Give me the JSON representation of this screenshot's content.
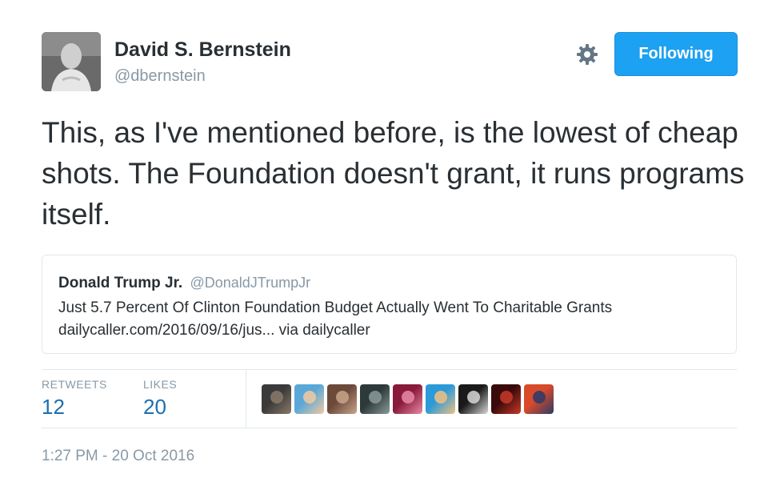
{
  "author": {
    "name": "David S. Bernstein",
    "handle": "@dbernstein"
  },
  "actions": {
    "follow_label": "Following",
    "settings_icon": "gear-icon"
  },
  "tweet": {
    "text": "This, as I've mentioned before, is the lowest of cheap shots. The Foundation doesn't grant, it runs programs itself."
  },
  "quoted_tweet": {
    "name": "Donald Trump Jr.",
    "handle": "@DonaldJTrumpJr",
    "line1": "Just 5.7 Percent Of Clinton Foundation Budget Actually Went To Charitable Grants",
    "line2": "dailycaller.com/2016/09/16/jus... via dailycaller"
  },
  "stats": {
    "retweets_label": "RETWEETS",
    "retweets_count": "12",
    "likes_label": "LIKES",
    "likes_count": "20"
  },
  "likers": [
    {
      "name": "liker-avatar-1",
      "colors": [
        "#3a3a3a",
        "#8a7a6a"
      ]
    },
    {
      "name": "liker-avatar-2",
      "colors": [
        "#5aa8d8",
        "#f2c9a0"
      ]
    },
    {
      "name": "liker-avatar-3",
      "colors": [
        "#6b4a3a",
        "#c9a48a"
      ]
    },
    {
      "name": "liker-avatar-4",
      "colors": [
        "#2e3a3a",
        "#8a9a9a"
      ]
    },
    {
      "name": "liker-avatar-5",
      "colors": [
        "#8a1a3a",
        "#e88aa8"
      ]
    },
    {
      "name": "liker-avatar-6",
      "colors": [
        "#2a9ad8",
        "#f2c080"
      ]
    },
    {
      "name": "liker-avatar-7",
      "colors": [
        "#1a1a1a",
        "#d8d8d8"
      ]
    },
    {
      "name": "liker-avatar-8",
      "colors": [
        "#3a0a0a",
        "#c83a2a"
      ]
    },
    {
      "name": "liker-avatar-9",
      "colors": [
        "#d84a2a",
        "#2a3a6a"
      ]
    }
  ],
  "timestamp": "1:27 PM - 20 Oct 2016",
  "colors": {
    "accent": "#1da1f2",
    "link": "#1b6fb0",
    "muted": "#8899a6",
    "text": "#292f33"
  }
}
